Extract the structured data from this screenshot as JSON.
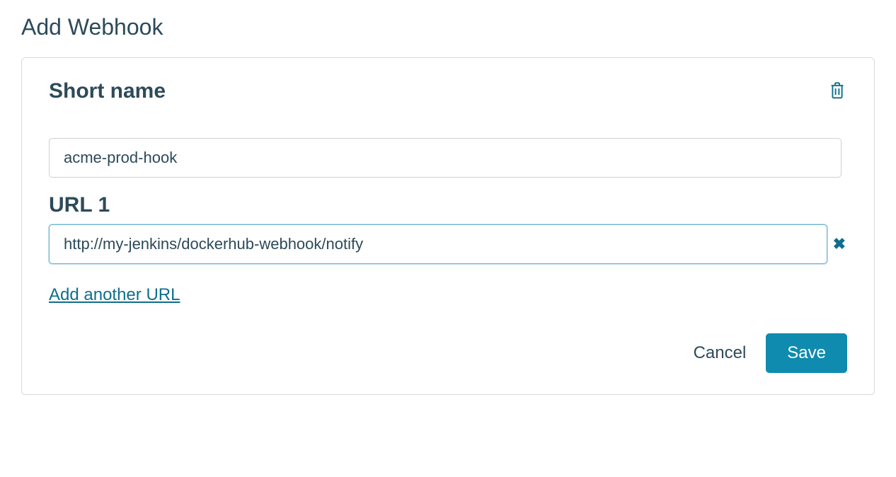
{
  "page": {
    "title": "Add Webhook"
  },
  "form": {
    "shortName": {
      "label": "Short name",
      "value": "acme-prod-hook"
    },
    "urls": [
      {
        "label": "URL 1",
        "value": "http://my-jenkins/dockerhub-webhook/notify"
      }
    ],
    "addUrlLabel": "Add another URL",
    "cancelLabel": "Cancel",
    "saveLabel": "Save"
  }
}
